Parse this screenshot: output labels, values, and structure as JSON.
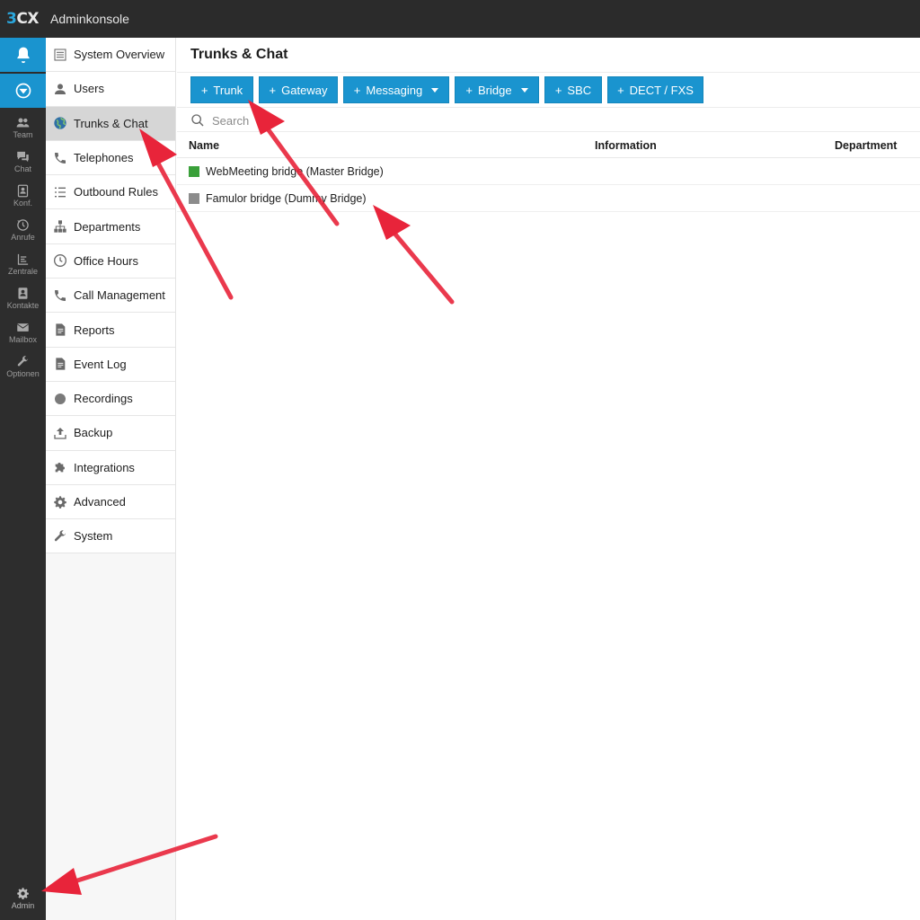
{
  "app": {
    "logo_prefix": "3",
    "logo_suffix": "CX",
    "title": "Adminkonsole"
  },
  "rail": {
    "items": [
      {
        "icon": "team-icon",
        "label": "Team"
      },
      {
        "icon": "chat-icon",
        "label": "Chat"
      },
      {
        "icon": "conference-icon",
        "label": "Konf."
      },
      {
        "icon": "calls-icon",
        "label": "Anrufe"
      },
      {
        "icon": "switchboard-icon",
        "label": "Zentrale"
      },
      {
        "icon": "contacts-icon",
        "label": "Kontakte"
      },
      {
        "icon": "mailbox-icon",
        "label": "Mailbox"
      },
      {
        "icon": "wrench-icon",
        "label": "Optionen"
      }
    ],
    "admin_label": "Admin"
  },
  "nav": {
    "items": [
      {
        "label": "System Overview",
        "icon": "list-icon"
      },
      {
        "label": "Users",
        "icon": "user-icon"
      },
      {
        "label": "Trunks & Chat",
        "icon": "globe-icon",
        "active": true
      },
      {
        "label": "Telephones",
        "icon": "phone-icon"
      },
      {
        "label": "Outbound Rules",
        "icon": "rules-icon"
      },
      {
        "label": "Departments",
        "icon": "departments-icon"
      },
      {
        "label": "Office Hours",
        "icon": "clock-icon"
      },
      {
        "label": "Call Management",
        "icon": "phone-icon"
      },
      {
        "label": "Reports",
        "icon": "document-icon"
      },
      {
        "label": "Event Log",
        "icon": "document-icon"
      },
      {
        "label": "Recordings",
        "icon": "record-icon"
      },
      {
        "label": "Backup",
        "icon": "upload-icon"
      },
      {
        "label": "Integrations",
        "icon": "puzzle-icon"
      },
      {
        "label": "Advanced",
        "icon": "gear-icon"
      },
      {
        "label": "System",
        "icon": "wrench-icon"
      }
    ]
  },
  "main": {
    "title": "Trunks & Chat",
    "toolbar": {
      "trunk": "Trunk",
      "gateway": "Gateway",
      "messaging": "Messaging",
      "bridge": "Bridge",
      "sbc": "SBC",
      "dect": "DECT / FXS"
    },
    "search_placeholder": "Search",
    "table": {
      "columns": [
        "Name",
        "Information",
        "Department"
      ],
      "rows": [
        {
          "name": "WebMeeting bridge (Master Bridge)",
          "status_color": "#3aa03a"
        },
        {
          "name": "Famulor bridge (Dummy Bridge)",
          "status_color": "#8c8c8c"
        }
      ]
    }
  },
  "colors": {
    "accent": "#1a94cf",
    "topbar": "#2b2b2b",
    "rail": "#2d2d2d",
    "annotation": "#e8243a"
  }
}
